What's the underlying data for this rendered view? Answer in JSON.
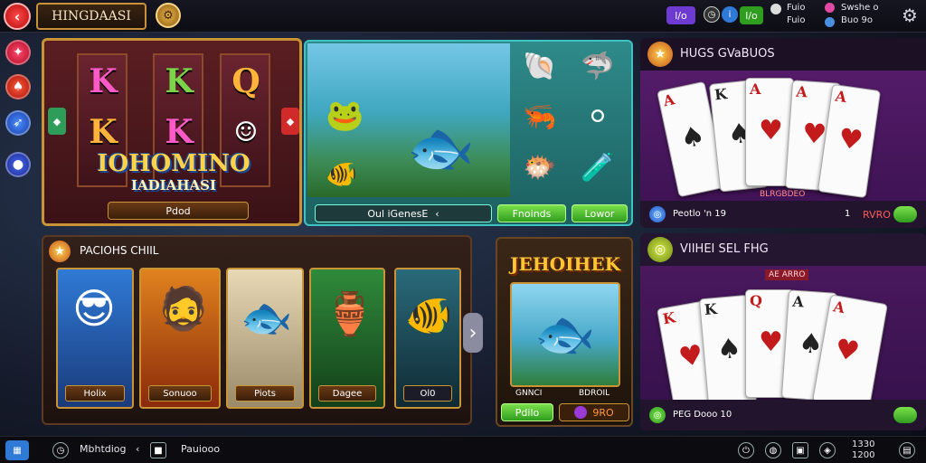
{
  "header": {
    "back_icon": "back-arrow-icon",
    "title": "HINGDAASI",
    "chip_purple": "l/o",
    "chip_green": "l/o",
    "label_a1": "Fuio",
    "label_a2": "Fuio",
    "label_b1": "Swshe o",
    "label_b2": "Buo 9o",
    "accent": "#c99436"
  },
  "sidebar": {
    "items": [
      "sidebar-a",
      "sidebar-b",
      "sidebar-c",
      "sidebar-d"
    ]
  },
  "slot": {
    "reels": [
      [
        "K",
        "K"
      ],
      [
        "K",
        "K"
      ],
      [
        "Q",
        ""
      ]
    ],
    "logo": "IOHOMINO",
    "logo_sub": "IADIAHASI",
    "button": "Pdod"
  },
  "fishing": {
    "search_label": "Oul iGenesE",
    "btn1": "Fnoinds",
    "btn2": "Lowor"
  },
  "cards_top": {
    "title": "HUGS GVaBUOS",
    "cards": [
      "A",
      "K",
      "A",
      "A",
      "A"
    ],
    "caption": "BLRGBDEO",
    "foot_label": "Peotlo 'n 19",
    "foot_num": "1",
    "foot_val": "RVRO"
  },
  "row": {
    "title": "PACIOHS CHIIL",
    "tiles": [
      "Holix",
      "Sonuoo",
      "Piots",
      "Dagee",
      "Ol0"
    ]
  },
  "feature": {
    "title": "JEHOIHEK",
    "lab1": "GNNCI",
    "lab2": "BDROIL",
    "btn": "Pdilo",
    "val": "9RO"
  },
  "cards_bottom": {
    "title": "VIIHEI SEL FHG",
    "caption": "AE ARRO",
    "cards": [
      "K",
      "K",
      "Q",
      "A",
      "A",
      "A"
    ],
    "foot_label": "PEG Dooo 10"
  },
  "status": {
    "item1": "Mbhtdiog",
    "item2": "Pauiooo",
    "nums1": "1330",
    "nums2": "1200"
  }
}
